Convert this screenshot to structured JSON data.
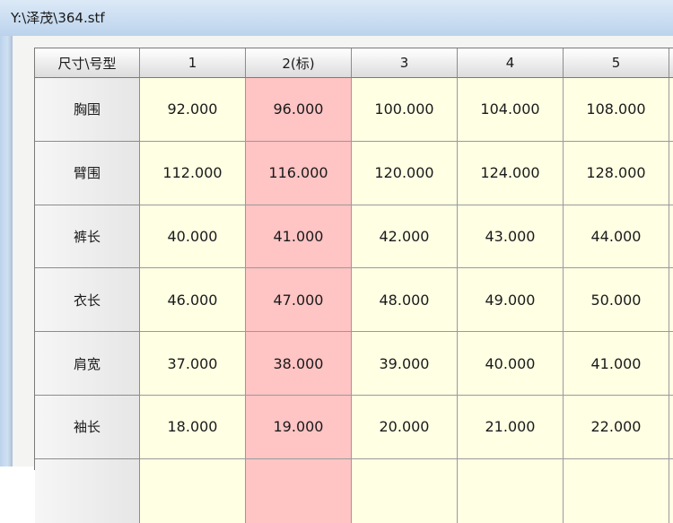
{
  "window": {
    "title": "Y:\\泽茂\\364.stf"
  },
  "table": {
    "corner_label": "尺寸\\号型",
    "standard_column_index": 1,
    "columns": [
      "1",
      "2(标)",
      "3",
      "4",
      "5"
    ],
    "rows": [
      {
        "label": "胸围",
        "values": [
          "92.000",
          "96.000",
          "100.000",
          "104.000",
          "108.000"
        ]
      },
      {
        "label": "臂围",
        "values": [
          "112.000",
          "116.000",
          "120.000",
          "124.000",
          "128.000"
        ]
      },
      {
        "label": "裤长",
        "values": [
          "40.000",
          "41.000",
          "42.000",
          "43.000",
          "44.000"
        ]
      },
      {
        "label": "衣长",
        "values": [
          "46.000",
          "47.000",
          "48.000",
          "49.000",
          "50.000"
        ]
      },
      {
        "label": "肩宽",
        "values": [
          "37.000",
          "38.000",
          "39.000",
          "40.000",
          "41.000"
        ]
      },
      {
        "label": "袖长",
        "values": [
          "18.000",
          "19.000",
          "20.000",
          "21.000",
          "22.000"
        ]
      },
      {
        "label": "",
        "values": [
          "",
          "",
          "",
          "",
          ""
        ]
      }
    ]
  },
  "colors": {
    "standard_column_bg": "#ffc4c4",
    "cell_bg": "#ffffe4",
    "titlebar": "#c9dcf1"
  }
}
